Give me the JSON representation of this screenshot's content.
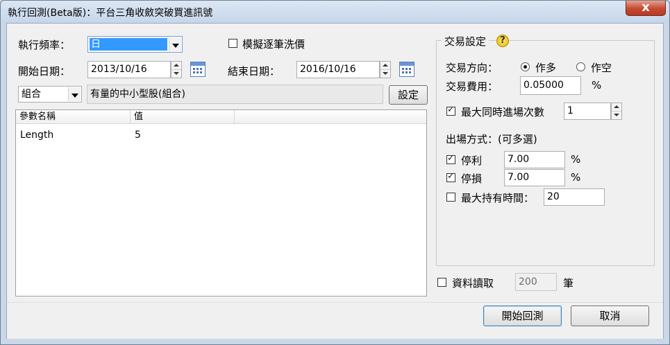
{
  "window": {
    "title": "執行回測(Beta版)：平台三角收斂突破買進訊號",
    "close_glyph": "x"
  },
  "left": {
    "frequency_label": "執行頻率：",
    "frequency_value": "日",
    "simulate_label": "模擬逐筆洗價",
    "simulate_checked": false,
    "start_label": "開始日期：",
    "start_value": "2013/10/16",
    "end_label": "結束日期：",
    "end_value": "2016/10/16",
    "scope_value": "組合",
    "scope_desc": "有量的中小型股(組合)",
    "settings_button": "設定"
  },
  "params": {
    "columns": [
      "參數名稱",
      "值"
    ],
    "rows": [
      {
        "name": "Length",
        "value": "5"
      }
    ]
  },
  "trade": {
    "group_title": "交易設定",
    "help_glyph": "?",
    "direction_label": "交易方向：",
    "long_label": "作多",
    "short_label": "作空",
    "selected": "long",
    "fee_label": "交易費用：",
    "fee_value": "0.05000",
    "fee_unit": "%",
    "max_entries_label": "最大同時進場次數",
    "max_entries_checked": true,
    "max_entries_value": "1",
    "exit_label": "出場方式：(可多選)",
    "take_profit_label": "停利",
    "take_profit_checked": true,
    "take_profit_value": "7.00",
    "take_profit_unit": "%",
    "stop_loss_label": "停損",
    "stop_loss_checked": true,
    "stop_loss_value": "7.00",
    "stop_loss_unit": "%",
    "max_hold_label": "最大持有時間：",
    "max_hold_checked": false,
    "max_hold_value": "20"
  },
  "data_read": {
    "label": "資料讀取",
    "checked": false,
    "value": "200",
    "unit": "筆"
  },
  "footer": {
    "start_button": "開始回測",
    "cancel_button": "取消"
  }
}
